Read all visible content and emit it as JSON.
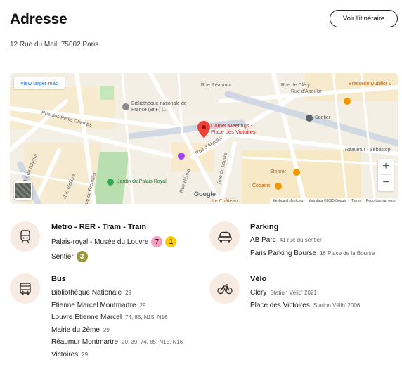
{
  "header": {
    "title": "Adresse",
    "address": "12 Rue du Mail, 75002 Paris",
    "route_button": "Voir l'itinéraire"
  },
  "map": {
    "view_larger": "View larger map",
    "zoom_in": "+",
    "zoom_out": "−",
    "google": "Google",
    "attribution": {
      "shortcuts": "Keyboard shortcuts",
      "data": "Map data ©2025 Google",
      "terms": "Terms",
      "report": "Report a map error"
    },
    "labels": {
      "rue_reaumur": "Rue Réaumur",
      "rue_de_clery": "Rue de Cléry",
      "rue_daboukir_top": "Rue d'Aboukir",
      "brasserie": "Brasserie Dubillot V",
      "bnf_line1": "Bibliothèque nationale de",
      "bnf_line2": "France (BnF) |...",
      "sentier": "Sentier",
      "rue_des_petits_champs": "Rue des Petits Champs",
      "comet_line1": "Comet Meetings -",
      "comet_line2": "Place des Victoires",
      "reaumur_sebastopol": "Réaumur - Sébastop",
      "rue_daboukir_mid": "Rue d'Aboukir",
      "av_de_lopera": "Av. de l'Opéra",
      "jardin": "Jardin du Palais Royal",
      "rue_du_louvre": "Rue du Louvre",
      "stohrer": "Stohrer",
      "copains": "Copains",
      "rue_moliere": "Rue Molière",
      "rue_de_richelieu": "Rue de Richelieu",
      "rue_herold": "Rue Hérold",
      "le_chateau": "Le Château"
    }
  },
  "metro": {
    "title": "Metro  - RER - Tram - Train",
    "stations": [
      {
        "name": "Palais-royal - Musée du Louvre",
        "lines": [
          "7",
          "1"
        ]
      },
      {
        "name": "Sentier",
        "lines": [
          "3"
        ]
      }
    ],
    "line_colors": {
      "7": "#f59ebd",
      "1": "#ffcd00",
      "3": "#9a9940"
    }
  },
  "parking": {
    "title": "Parking",
    "items": [
      {
        "name": "AB Parc",
        "detail": "41 rue du sentier"
      },
      {
        "name": "Paris Parking Bourse",
        "detail": "16 Place de la Bourse"
      }
    ]
  },
  "bus": {
    "title": "Bus",
    "items": [
      {
        "name": "Bibliothèque Nationale",
        "detail": "29"
      },
      {
        "name": "Etienne Marcel Montmartre",
        "detail": "29"
      },
      {
        "name": "Louvre Etienne Marcel",
        "detail": "74, 85, N15, N16"
      },
      {
        "name": "Mairie du 2ème",
        "detail": "29"
      },
      {
        "name": "Réaumur Montmartre",
        "detail": "20, 39, 74, 85, N15, N16"
      },
      {
        "name": "Victoires",
        "detail": "29"
      }
    ]
  },
  "velo": {
    "title": "Vélo",
    "items": [
      {
        "name": "Clery",
        "detail": "Station Vélib' 2021"
      },
      {
        "name": "Place des Victoires",
        "detail": "Station Vélib' 2006"
      }
    ]
  },
  "colors": {
    "icon_circle": "#f8ece2",
    "icon_stroke": "#333333",
    "map_pin": "#ea4335"
  }
}
